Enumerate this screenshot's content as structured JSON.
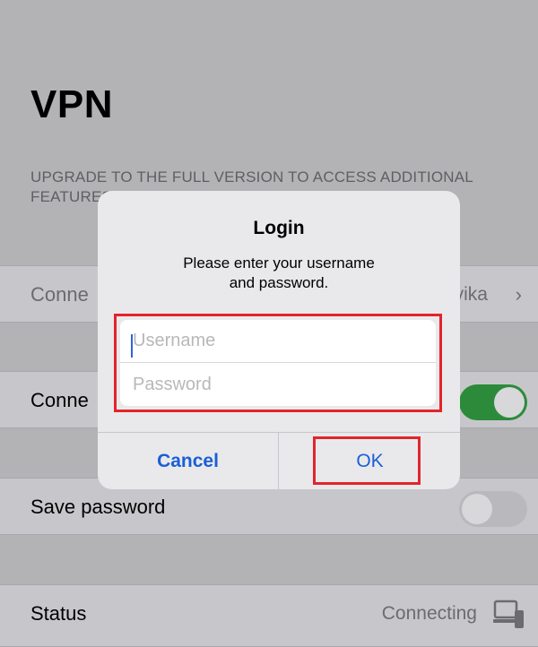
{
  "page": {
    "title": "VPN",
    "upgrade_note": "UPGRADE TO THE FULL VERSION TO ACCESS ADDITIONAL FEATURES"
  },
  "rows": {
    "connection": {
      "label": "Conne",
      "value": "vika",
      "chevron": "›"
    },
    "connect": {
      "label": "Conne",
      "toggle_state": "on"
    },
    "save_password": {
      "label": "Save password",
      "toggle_state": "off"
    },
    "status": {
      "label": "Status",
      "value": "Connecting",
      "icon": "network-computer-icon"
    }
  },
  "dialog": {
    "title": "Login",
    "message": "Please enter your username\nand password.",
    "username_placeholder": "Username",
    "password_placeholder": "Password",
    "cancel_label": "Cancel",
    "ok_label": "OK"
  },
  "colors": {
    "accent_blue": "#1a5fd4",
    "toggle_on": "#2c8b3b",
    "highlight_red": "#e3242b"
  }
}
